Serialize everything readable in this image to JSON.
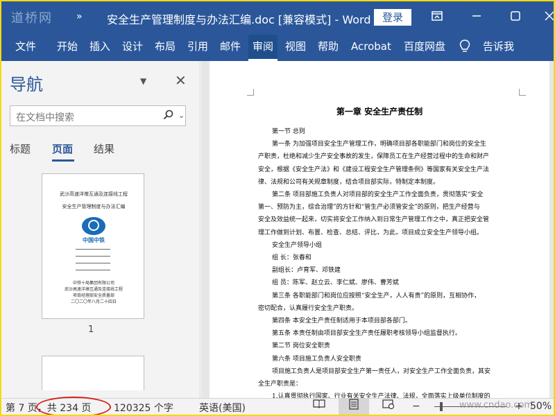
{
  "title_bar": {
    "watermark": "道桥网",
    "quick_access_more": "»",
    "document_title": "安全生产管理制度与办法汇编.doc [兼容模式] - Word",
    "login_label": "登录",
    "icons": [
      "ribbon-display-icon",
      "minimize-icon",
      "maximize-icon",
      "close-icon"
    ]
  },
  "ribbon": {
    "tabs": [
      {
        "label": "文件",
        "active": false
      },
      {
        "label": "开始",
        "active": false
      },
      {
        "label": "插入",
        "active": false
      },
      {
        "label": "设计",
        "active": false
      },
      {
        "label": "布局",
        "active": false
      },
      {
        "label": "引用",
        "active": false
      },
      {
        "label": "邮件",
        "active": false
      },
      {
        "label": "审阅",
        "active": true
      },
      {
        "label": "视图",
        "active": false
      },
      {
        "label": "帮助",
        "active": false
      },
      {
        "label": "Acrobat",
        "active": false
      },
      {
        "label": "百度网盘",
        "active": false
      }
    ],
    "tell_me": "告诉我",
    "tell_me_icon": "lightbulb-icon"
  },
  "navigation": {
    "title": "导航",
    "search_placeholder": "在文档中搜索",
    "tabs": [
      {
        "label": "标题",
        "active": false
      },
      {
        "label": "页面",
        "active": true
      },
      {
        "label": "结果",
        "active": false
      }
    ],
    "thumbnail": {
      "line1": "武沙高速洋墩互通及连接线工程",
      "line2": "安全生产管理制度与办法汇编",
      "logo_text": "中国中铁",
      "footer1": "中铁十局集团有限公司",
      "footer2": "武沙高速洋墩互通及连接线工程",
      "footer3": "项目经理部安全质量部",
      "footer4": "二〇二〇年八月二十四日",
      "page_number": "1"
    }
  },
  "document": {
    "chapter_title": "第一章  安全生产责任制",
    "lines": [
      {
        "text": "第一节  总则",
        "indent": 1
      },
      {
        "text": "第一条  为加强项目安全生产管理工作，明确项目部各职能部门和岗位的安全生",
        "indent": 1
      },
      {
        "text": "产职责，杜绝和减少生产安全事故的发生，保障员工在生产经营过程中的生命和财产",
        "indent": 0
      },
      {
        "text": "安全，根据《安全生产法》和《建设工程安全生产管理条例》等国家有关安全生产法",
        "indent": 0
      },
      {
        "text": "律、法规和公司有关规章制度，结合项目部实际，特制定本制度。",
        "indent": 0
      },
      {
        "text": "第二条  项目部施工负责人对项目部的安全生产工作全面负责，贯彻落实“安全",
        "indent": 1
      },
      {
        "text": "第一、预防为主，综合治理”的方针和“管生产必须管安全”的原则，把生产经营与",
        "indent": 0
      },
      {
        "text": "安全及效益统一起来，切实将安全工作纳入到日常生产管理工作之中，真正把安全管",
        "indent": 0
      },
      {
        "text": "理工作做到计划、布置、检查、总结、评比，为此，项目成立安全生产领导小组。",
        "indent": 0
      },
      {
        "text": "安全生产领导小组",
        "indent": 1
      },
      {
        "text": "组  长：张春和",
        "indent": 1
      },
      {
        "text": "副组长：卢育军、邓铁建",
        "indent": 1
      },
      {
        "text": "组  员：陈军、赵立云、李仁斌、廖伟、曹芳斌",
        "indent": 1
      },
      {
        "text": "第三条  各职能部门和岗位应按照“安全生产，人人有责”的原则，互相协作，",
        "indent": 1
      },
      {
        "text": "密切配合，认真履行安全生产职责。",
        "indent": 0
      },
      {
        "text": "第四条  本安全生产责任制适用于本项目部各部门。",
        "indent": 1
      },
      {
        "text": "第五条  本责任制由项目部安全生产责任履职考核领导小组监督执行。",
        "indent": 1
      },
      {
        "text": "第二节  岗位安全职责",
        "indent": 1
      },
      {
        "text": "第六条  项目施工负责人安全职责",
        "indent": 1
      },
      {
        "text": "项目施工负责人是项目部安全生产第一责任人，对安全生产工作全面负责，其安",
        "indent": 1
      },
      {
        "text": "全生产职责是：",
        "indent": 0
      },
      {
        "text": "1.认真贯彻执行国家、行业有关安全生产法律、法规，全面落实上级单位制度的",
        "indent": 1
      }
    ]
  },
  "status_bar": {
    "page_info": "第 7 页，共 234 页",
    "word_count": "120325 个字",
    "language": "英语(美国)",
    "views": [
      {
        "name": "read-mode-icon",
        "active": false
      },
      {
        "name": "print-layout-icon",
        "active": true
      },
      {
        "name": "web-layout-icon",
        "active": false
      }
    ],
    "zoom_minus": "−",
    "zoom_plus": "+",
    "zoom_level": "50%",
    "watermark": "www.cndao.com",
    "zoom_fraction": 0.5
  },
  "colors": {
    "brand": "#2b579a",
    "annotation": "#d42020",
    "frame": "#f5d90a"
  }
}
